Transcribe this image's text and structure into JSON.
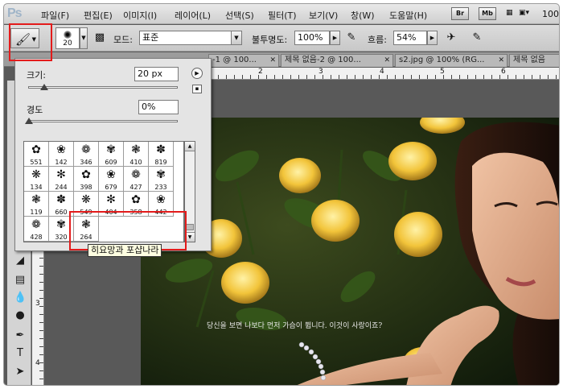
{
  "app": {
    "logo": "Ps"
  },
  "menu": [
    {
      "label": "파일(F)"
    },
    {
      "label": "편집(E)"
    },
    {
      "label": "이미지(I)"
    },
    {
      "label": "레이어(L)"
    },
    {
      "label": "선택(S)"
    },
    {
      "label": "필터(T)"
    },
    {
      "label": "보기(V)"
    },
    {
      "label": "창(W)"
    },
    {
      "label": "도움말(H)"
    }
  ],
  "menu_buttons": {
    "bridge": "Br",
    "mini_bridge": "Mb",
    "zoom": "100"
  },
  "options": {
    "brush_size": "20",
    "mode_label": "모드:",
    "mode_value": "표준",
    "opacity_label": "불투명도:",
    "opacity_value": "100%",
    "flow_label": "흐름:",
    "flow_value": "54%"
  },
  "tabs": [
    {
      "label": "-1 @ 100..."
    },
    {
      "label": "제목 없음-2 @ 100..."
    },
    {
      "label": "s2.jpg @ 100% (RG..."
    },
    {
      "label": "제목 없음"
    }
  ],
  "ruler": {
    "h": [
      "2",
      "3",
      "4",
      "5",
      "6"
    ],
    "v": [
      "3",
      "4"
    ]
  },
  "brush_picker": {
    "size_label": "크기:",
    "size_value": "20 px",
    "hardness_label": "경도",
    "hardness_value": "0%",
    "size_slider_fraction": 0.1,
    "hardness_slider_fraction": 0.0,
    "presets": [
      "551",
      "142",
      "346",
      "609",
      "410",
      "819",
      "134",
      "244",
      "398",
      "679",
      "427",
      "233",
      "119",
      "660",
      "549",
      "404",
      "358",
      "442",
      "428",
      "320",
      "264"
    ],
    "tooltip": "히요망과 포샵나라"
  },
  "canvas": {
    "caption": "당신을 보면 나보다 먼저 가슴이 뜁니다. 이것이 사랑이죠?"
  },
  "colors": {
    "highlight": "#e31b1b"
  }
}
